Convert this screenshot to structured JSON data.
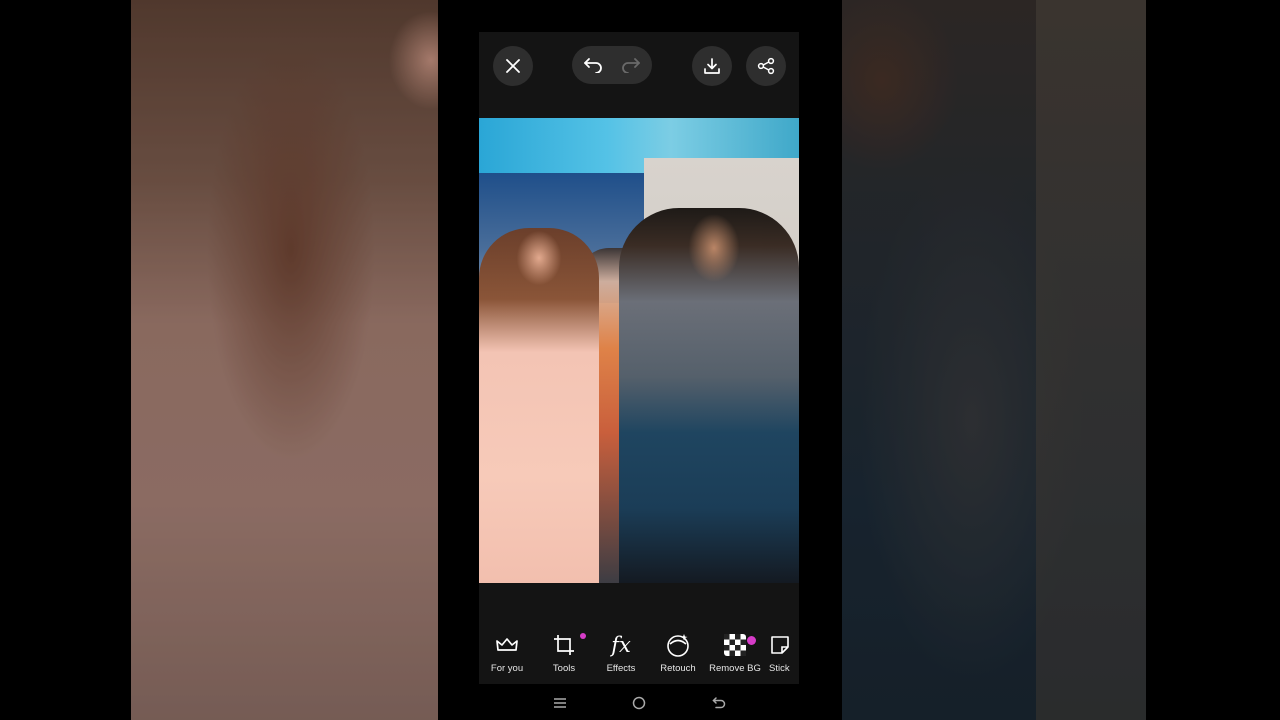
{
  "top_bar": {
    "close_icon": "close-icon",
    "undo_icon": "undo-icon",
    "redo_icon": "redo-icon",
    "download_icon": "download-icon",
    "share_icon": "share-icon"
  },
  "toolbar": {
    "items": [
      {
        "label": "For you",
        "icon": "crown-icon"
      },
      {
        "label": "Tools",
        "icon": "crop-icon",
        "badge": true
      },
      {
        "label": "Effects",
        "icon": "fx-icon"
      },
      {
        "label": "Retouch",
        "icon": "retouch-face-icon"
      },
      {
        "label": "Remove BG",
        "icon": "checkerboard-icon",
        "badge": true
      },
      {
        "label": "Stick",
        "icon": "sticker-icon"
      }
    ]
  },
  "colors": {
    "accent_badge": "#d63cc8",
    "panel_bg": "#141414",
    "button_bg": "#2e2e2e"
  }
}
